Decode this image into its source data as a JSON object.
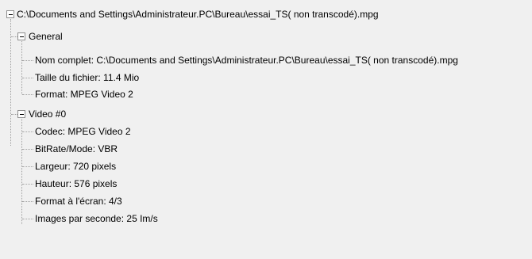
{
  "tree": {
    "root": {
      "label": "C:\\Documents and Settings\\Administrateur.PC\\Bureau\\essai_TS( non transcodé).mpg",
      "expanded": true,
      "children": [
        {
          "label": "General",
          "expanded": true,
          "items": [
            "Nom complet: C:\\Documents and Settings\\Administrateur.PC\\Bureau\\essai_TS( non transcodé).mpg",
            "Taille du fichier: 11.4 Mio",
            "Format: MPEG Video 2"
          ]
        },
        {
          "label": "Video #0",
          "expanded": true,
          "items": [
            "Codec: MPEG Video 2",
            "BitRate/Mode: VBR",
            "Largeur: 720 pixels",
            "Hauteur: 576 pixels",
            "Format à l'écran: 4/3",
            "Images par seconde: 25 Im/s"
          ]
        }
      ]
    }
  }
}
